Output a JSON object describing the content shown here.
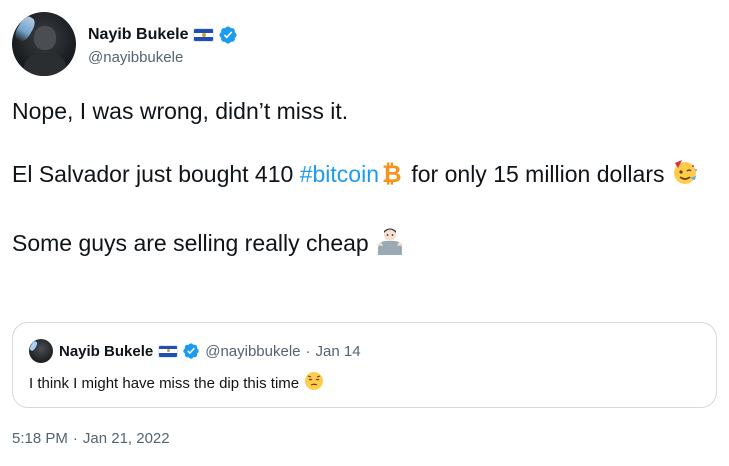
{
  "author": {
    "name": "Nayib Bukele",
    "handle": "@nayibbukele",
    "flag_icon": "el-salvador-flag-icon",
    "verified_icon": "verified-badge-icon"
  },
  "tweet": {
    "line1": "Nope, I was wrong, didn’t miss it.",
    "line2_prefix": "El Salvador just bought 410 ",
    "hashtag": "#bitcoin",
    "line2_suffix": " for only 15 million dollars",
    "line3": "Some guys are selling really cheap",
    "emojis": [
      "bitcoin-emoji",
      "partying-face-emoji",
      "man-shrugging-emoji"
    ]
  },
  "quoted_tweet": {
    "name": "Nayib Bukele",
    "handle": "@nayibbukele",
    "separator": "·",
    "date": "Jan 14",
    "text": "I think I might have miss the dip this time",
    "emoji": "pensive-face-emoji"
  },
  "timestamp": {
    "time": "5:18 PM",
    "separator": "·",
    "date": "Jan 21, 2022"
  },
  "colors": {
    "link": "#1d9bf0",
    "secondary_text": "#536471",
    "border": "#cfd9de",
    "verified": "#1d9bf0",
    "bitcoin": "#f7931a"
  }
}
